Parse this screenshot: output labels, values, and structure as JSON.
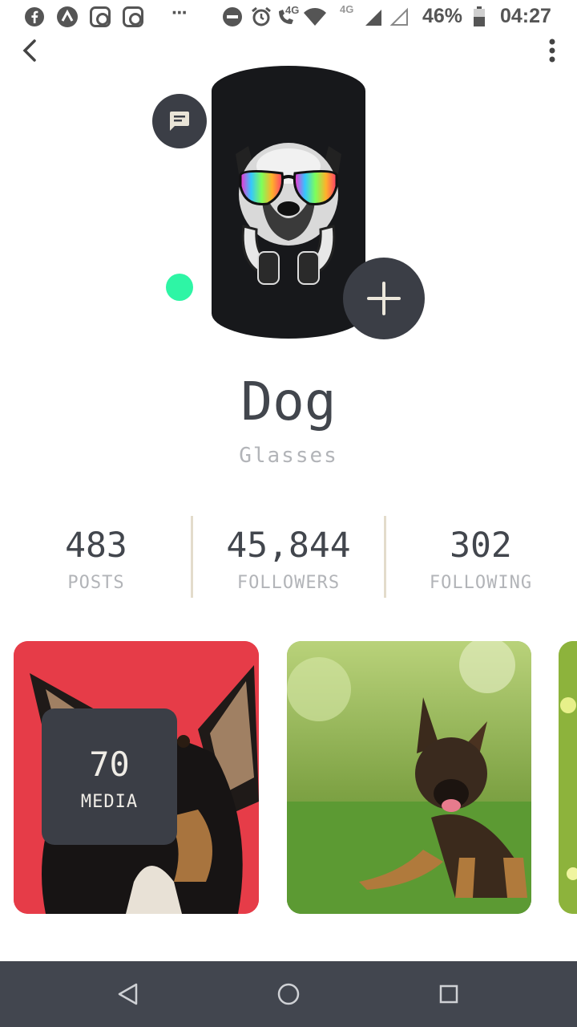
{
  "status_bar": {
    "battery": "46%",
    "time": "04:27",
    "dots": "···",
    "net_4g_a": "4G",
    "net_4g_b": "4G"
  },
  "profile": {
    "name": "Dog",
    "subtitle": "Glasses"
  },
  "stats": [
    {
      "value": "483",
      "label": "POSTS"
    },
    {
      "value": "45,844",
      "label": "FOLLOWERS"
    },
    {
      "value": "302",
      "label": "FOLLOWING"
    }
  ],
  "media": {
    "count": "70",
    "label": "MEDIA"
  },
  "colors": {
    "accent_online": "#2ef5a5",
    "dark_button": "#3b3e46",
    "navbar": "#42464f",
    "card1_bg": "#e83a4a",
    "card2_bg": "#7ca84a"
  },
  "icons": [
    "facebook-icon",
    "arrow-up-icon",
    "instagram-icon",
    "instagram-icon",
    "dnd-icon",
    "alarm-icon",
    "volte-call-icon",
    "wifi-icon",
    "signal-icon",
    "signal-empty-icon",
    "battery-icon",
    "back-arrow-icon",
    "more-vertical-icon",
    "message-icon",
    "plus-icon",
    "nav-back-icon",
    "nav-home-icon",
    "nav-recents-icon"
  ]
}
